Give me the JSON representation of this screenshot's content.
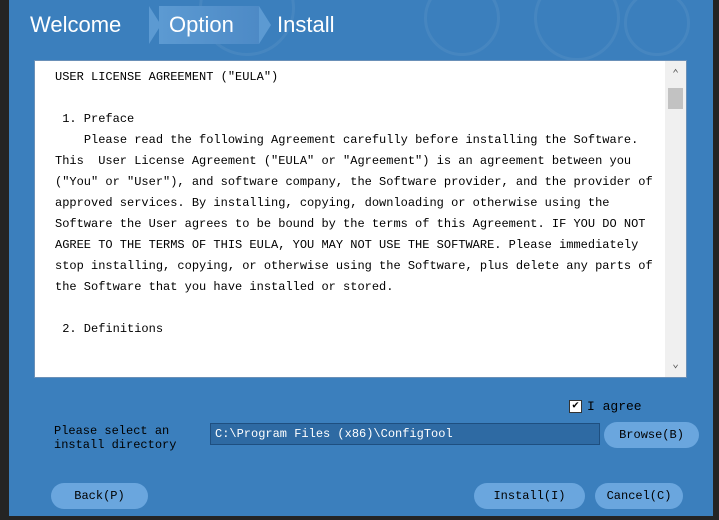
{
  "steps": {
    "welcome": "Welcome",
    "option": "Option",
    "install": "Install"
  },
  "eula": {
    "text": "USER LICENSE AGREEMENT (\"EULA\")\n\n 1. Preface\n    Please read the following Agreement carefully before installing the Software.\nThis  User License Agreement (\"EULA\" or \"Agreement\") is an agreement between you (\"You\" or \"User\"), and software company, the Software provider, and the provider of approved services. By installing, copying, downloading or otherwise using the Software the User agrees to be bound by the terms of this Agreement. IF YOU DO NOT AGREE TO THE TERMS OF THIS EULA, YOU MAY NOT USE THE SOFTWARE. Please immediately stop installing, copying, or otherwise using the Software, plus delete any parts of the Software that you have installed or stored.\n\n 2. Definitions",
    "scroll_up_icon": "chevron-up-icon",
    "scroll_down_icon": "chevron-down-icon"
  },
  "agree": {
    "checked": true,
    "label": "I agree"
  },
  "directory": {
    "label": "Please select an\ninstall directory",
    "value": "C:\\Program Files (x86)\\ConfigTool"
  },
  "buttons": {
    "browse": "Browse(B)",
    "back": "Back(P)",
    "install": "Install(I)",
    "cancel": "Cancel(C)"
  },
  "colors": {
    "background": "#3b7fbd",
    "button": "#6aa6de",
    "input": "#2e6aa3"
  }
}
